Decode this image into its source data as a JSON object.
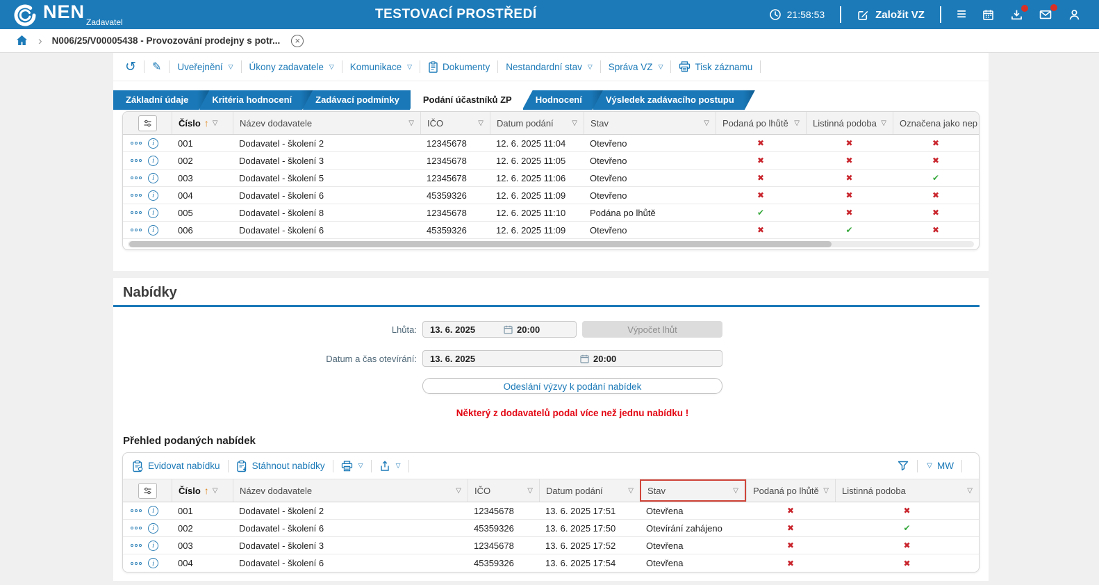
{
  "colors": {
    "accent_blue": "#1c7ab8",
    "danger_red": "#c9252d",
    "success_green": "#36a93c",
    "warning_red": "#e30613",
    "badge_red": "#d93025",
    "highlight_border_red": "#d0453a"
  },
  "topbar": {
    "brand": "NEN",
    "brand_sub": "Zadavatel",
    "env_title": "TESTOVACÍ PROSTŘEDÍ",
    "clock": "21:58:53",
    "create_vz_label": "Založit VZ"
  },
  "breadcrumb": {
    "item": "N006/25/V00005438 - Provozování prodejny s potr..."
  },
  "action_bar": {
    "uverejneni": "Uveřejnění",
    "ukony_zadavatele": "Úkony zadavatele",
    "komunikace": "Komunikace",
    "dokumenty": "Dokumenty",
    "nestandardni_stav": "Nestandardní stav",
    "sprava_vz": "Správa VZ",
    "tisk_zaznamu": "Tisk záznamu"
  },
  "tabs": {
    "items": [
      {
        "label": "Základní údaje",
        "active": false
      },
      {
        "label": "Kritéria hodnocení",
        "active": false
      },
      {
        "label": "Zadávací podmínky",
        "active": false
      },
      {
        "label": "Podání účastníků ZP",
        "active": true
      },
      {
        "label": "Hodnocení",
        "active": false
      },
      {
        "label": "Výsledek zadávacího postupu",
        "active": false
      }
    ]
  },
  "podani_table": {
    "columns": {
      "cislo": "Číslo",
      "nazev": "Název dodavatele",
      "ico": "IČO",
      "datum": "Datum podání",
      "stav": "Stav",
      "po_lhute": "Podaná po lhůtě",
      "listinna": "Listinná podoba",
      "oznacena": "Označena jako nep"
    },
    "sort": {
      "column": "Číslo",
      "direction": "asc"
    },
    "rows": [
      {
        "cislo": "001",
        "nazev": "Dodavatel - školení 2",
        "ico": "12345678",
        "datum": "12. 6. 2025 11:04",
        "stav": "Otevřeno",
        "po_lhute": false,
        "listinna": false,
        "oznacena": false
      },
      {
        "cislo": "002",
        "nazev": "Dodavatel - školení 3",
        "ico": "12345678",
        "datum": "12. 6. 2025 11:05",
        "stav": "Otevřeno",
        "po_lhute": false,
        "listinna": false,
        "oznacena": false
      },
      {
        "cislo": "003",
        "nazev": "Dodavatel - školení 5",
        "ico": "12345678",
        "datum": "12. 6. 2025 11:06",
        "stav": "Otevřeno",
        "po_lhute": false,
        "listinna": false,
        "oznacena": true
      },
      {
        "cislo": "004",
        "nazev": "Dodavatel - školení 6",
        "ico": "45359326",
        "datum": "12. 6. 2025 11:09",
        "stav": "Otevřeno",
        "po_lhute": false,
        "listinna": false,
        "oznacena": false
      },
      {
        "cislo": "005",
        "nazev": "Dodavatel - školení 8",
        "ico": "12345678",
        "datum": "12. 6. 2025 11:10",
        "stav": "Podána po lhůtě",
        "po_lhute": true,
        "listinna": false,
        "oznacena": false
      },
      {
        "cislo": "006",
        "nazev": "Dodavatel - školení 6",
        "ico": "45359326",
        "datum": "12. 6. 2025 11:09",
        "stav": "Otevřeno",
        "po_lhute": false,
        "listinna": true,
        "oznacena": false
      }
    ]
  },
  "nabidky": {
    "section_title": "Nabídky",
    "lhuta": {
      "label": "Lhůta:",
      "date": "13. 6. 2025",
      "time": "20:00"
    },
    "vypocet_lhut_label": "Výpočet lhůt",
    "oteviranie": {
      "label": "Datum a čas otevírání:",
      "date": "13. 6. 2025",
      "time": "20:00"
    },
    "odeslani_vyzvy_label": "Odeslání výzvy k podání nabídek",
    "warning": "Některý z dodavatelů podal více než jednu nabídku !",
    "prehled_title": "Přehled podaných nabídek",
    "toolbar": {
      "evidovat": "Evidovat nabídku",
      "stahnout": "Stáhnout nabídky",
      "view_label": "MW"
    }
  },
  "nabidky_table": {
    "columns": {
      "cislo": "Číslo",
      "nazev": "Název dodavatele",
      "ico": "IČO",
      "datum": "Datum podání",
      "stav": "Stav",
      "po_lhute": "Podaná po lhůtě",
      "listinna": "Listinná podoba"
    },
    "sort": {
      "column": "Číslo",
      "direction": "asc"
    },
    "rows": [
      {
        "cislo": "001",
        "nazev": "Dodavatel - školení 2",
        "ico": "12345678",
        "datum": "13. 6. 2025 17:51",
        "stav": "Otevřena",
        "po_lhute": false,
        "listinna": false
      },
      {
        "cislo": "002",
        "nazev": "Dodavatel - školení 6",
        "ico": "45359326",
        "datum": "13. 6. 2025 17:50",
        "stav": "Otevírání zahájeno",
        "po_lhute": false,
        "listinna": true
      },
      {
        "cislo": "003",
        "nazev": "Dodavatel - školení 3",
        "ico": "12345678",
        "datum": "13. 6. 2025 17:52",
        "stav": "Otevřena",
        "po_lhute": false,
        "listinna": false
      },
      {
        "cislo": "004",
        "nazev": "Dodavatel - školení 6",
        "ico": "45359326",
        "datum": "13. 6. 2025 17:54",
        "stav": "Otevřena",
        "po_lhute": false,
        "listinna": false
      }
    ]
  },
  "glyphs": {
    "filter": "▽",
    "sort_asc": "↑",
    "chevron": "›",
    "menu": "≡",
    "back": "↺",
    "pencil": "✎",
    "info": "i",
    "close": "×"
  },
  "icons": {
    "logo": "nen-ring-logo",
    "clock": "clock-icon",
    "edit": "edit-square-icon",
    "calendar": "calendar-icon",
    "download": "download-tray-icon",
    "mail": "envelope-icon",
    "user": "person-icon",
    "home": "home-icon",
    "document": "clipboard-icon",
    "printer": "printer-icon",
    "filter_funnel": "funnel-icon",
    "export": "export-icon",
    "columns": "column-settings-icon"
  }
}
